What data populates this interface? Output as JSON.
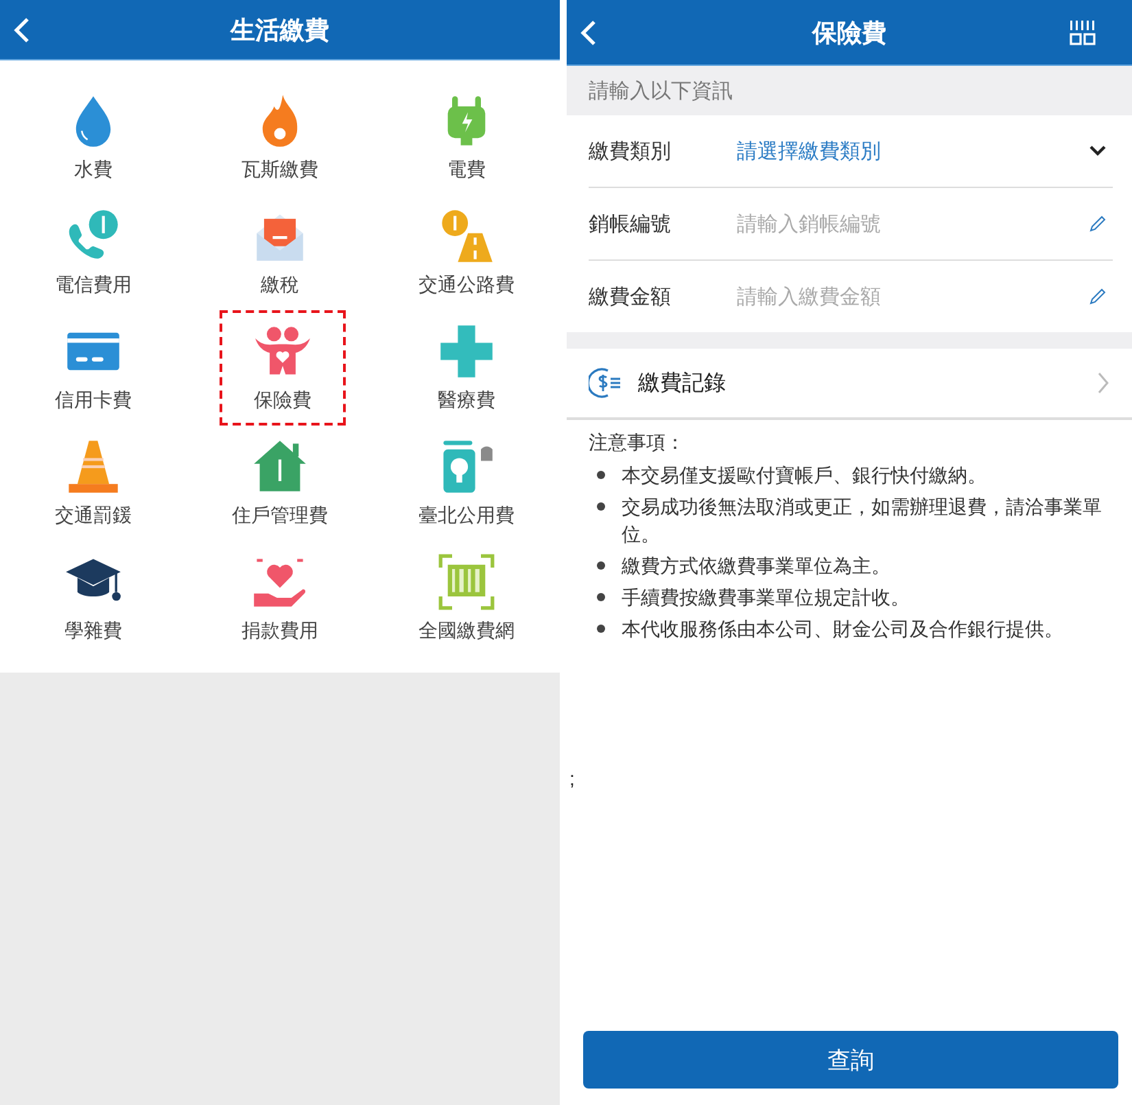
{
  "left_screen": {
    "header": {
      "title": "生活繳費"
    },
    "items": [
      {
        "label": "水費",
        "selected": false
      },
      {
        "label": "瓦斯繳費",
        "selected": false
      },
      {
        "label": "電費",
        "selected": false
      },
      {
        "label": "電信費用",
        "selected": false
      },
      {
        "label": "繳稅",
        "selected": false
      },
      {
        "label": "交通公路費",
        "selected": false
      },
      {
        "label": "信用卡費",
        "selected": false
      },
      {
        "label": "保險費",
        "selected": true
      },
      {
        "label": "醫療費",
        "selected": false
      },
      {
        "label": "交通罰鍰",
        "selected": false
      },
      {
        "label": "住戶管理費",
        "selected": false
      },
      {
        "label": "臺北公用費",
        "selected": false
      },
      {
        "label": "學雜費",
        "selected": false
      },
      {
        "label": "捐款費用",
        "selected": false
      },
      {
        "label": "全國繳費網",
        "selected": false
      }
    ]
  },
  "right_screen": {
    "header": {
      "title": "保險費"
    },
    "section_label": "請輸入以下資訊",
    "fields": [
      {
        "kind": "select",
        "label": "繳費類別",
        "placeholder": "請選擇繳費類別"
      },
      {
        "kind": "text",
        "label": "銷帳編號",
        "placeholder": "請輸入銷帳編號"
      },
      {
        "kind": "text",
        "label": "繳費金額",
        "placeholder": "請輸入繳費金額"
      }
    ],
    "history_link": "繳費記錄",
    "notes": {
      "title": "注意事項：",
      "items": [
        "本交易僅支援歐付寶帳戶、銀行快付繳納。",
        "交易成功後無法取消或更正，如需辦理退費，請洽事業單位。",
        "繳費方式依繳費事業單位為主。",
        "手續費按繳費事業單位規定計收。",
        "本代收服務係由本公司、財金公司及合作銀行提供。"
      ]
    },
    "stray_mark": ";",
    "submit_button": "查詢"
  }
}
